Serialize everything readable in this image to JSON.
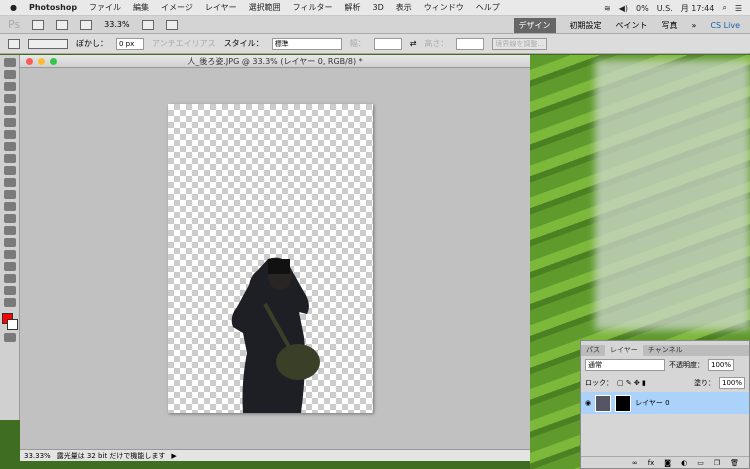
{
  "menubar": {
    "app": "Photoshop",
    "items": [
      "ファイル",
      "編集",
      "イメージ",
      "レイヤー",
      "選択範囲",
      "フィルター",
      "解析",
      "3D",
      "表示",
      "ウィンドウ",
      "ヘルプ"
    ],
    "battery": "0%",
    "input": "U.S.",
    "clock": "月 17:44"
  },
  "appbar": {
    "logo": "Ps",
    "zoom": "33.3%",
    "workspaces": [
      "デザイン",
      "初期設定",
      "ペイント",
      "写真"
    ],
    "more": "»",
    "cslive": "CS Live"
  },
  "options": {
    "feather_label": "ぼかし：",
    "feather_value": "0 px",
    "antialias": "アンチエイリアス",
    "style_label": "スタイル：",
    "style_value": "標準",
    "width_label": "幅：",
    "height_label": "高さ：",
    "refine": "境界線を調整..."
  },
  "document": {
    "title": "人_後ろ姿.JPG @ 33.3% (レイヤー 0, RGB/8) *",
    "zoom": "33.33%",
    "status": "露光量は 32 bit だけで機能します"
  },
  "layers": {
    "tabs": [
      "パス",
      "レイヤー",
      "チャンネル"
    ],
    "blend": "通常",
    "opacity_label": "不透明度：",
    "opacity": "100%",
    "lock_label": "ロック：",
    "fill_label": "塗り：",
    "fill": "100%",
    "layer_name": "レイヤー 0",
    "footer": [
      "fx"
    ]
  },
  "colors": {
    "foreground": "#ff0000",
    "background": "#ffffff",
    "selected_layer": "#aad2fb"
  }
}
